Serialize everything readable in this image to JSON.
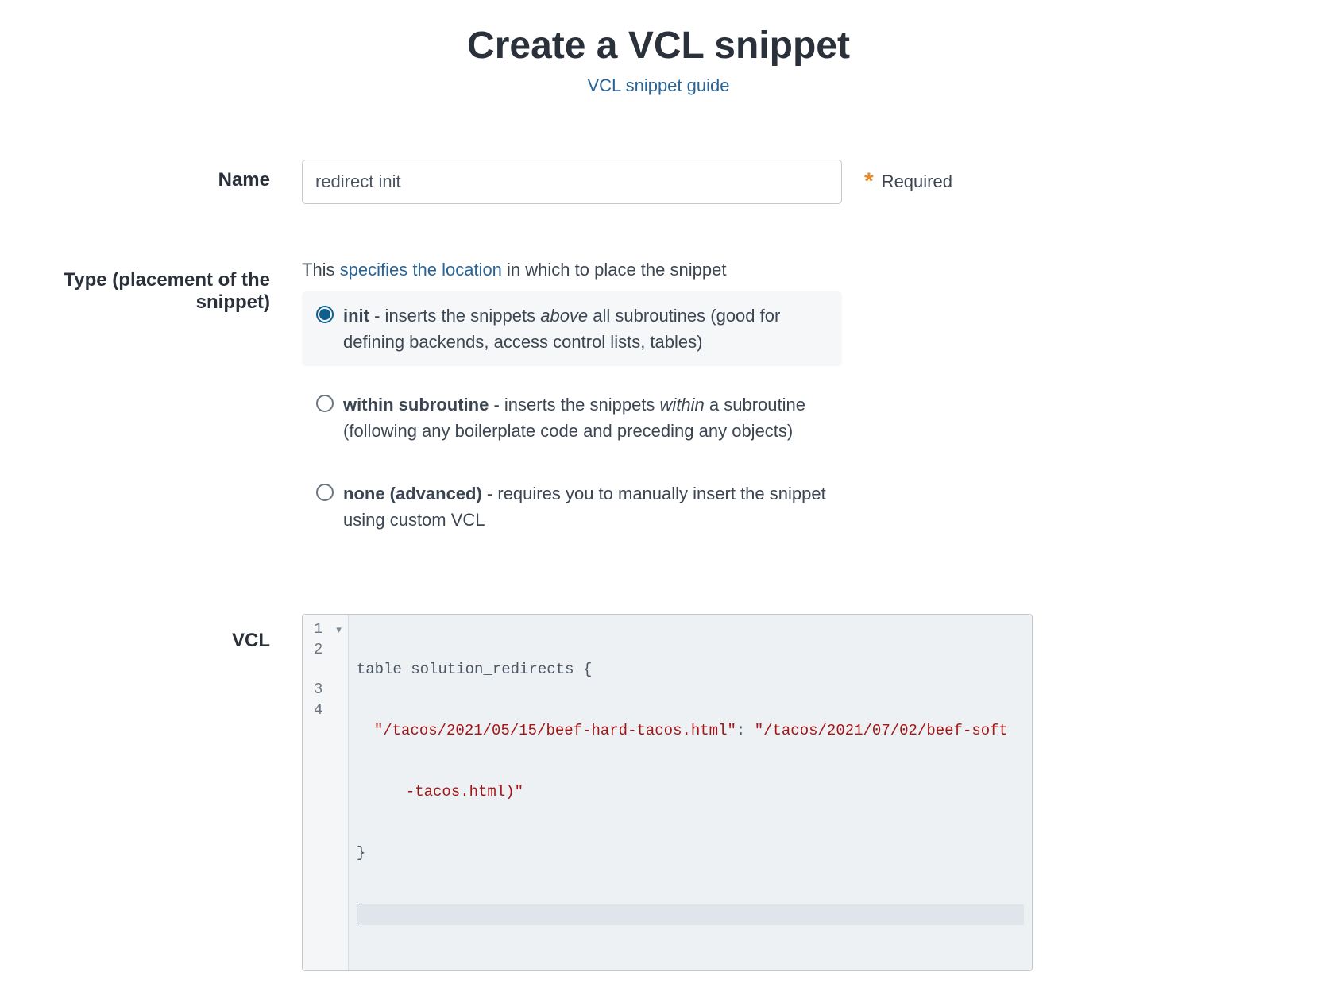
{
  "header": {
    "title": "Create a VCL snippet",
    "guide_link": "VCL snippet guide"
  },
  "name": {
    "label": "Name",
    "value": "redirect init",
    "required_marker": "*",
    "required_text": "Required"
  },
  "type": {
    "label": "Type (placement of the snippet)",
    "intro_prefix": "This ",
    "intro_link": "specifies the location",
    "intro_suffix": " in which to place the snippet",
    "options": [
      {
        "name": "init",
        "desc_before": " - inserts the snippets ",
        "desc_em": "above",
        "desc_after": " all subroutines (good for defining backends, access control lists, tables)",
        "selected": true
      },
      {
        "name": "within subroutine",
        "desc_before": " - inserts the snippets ",
        "desc_em": "within",
        "desc_after": " a subroutine (following any boilerplate code and preceding any objects)",
        "selected": false
      },
      {
        "name": "none (advanced)",
        "desc_before": " - requires you to manually insert the snippet using custom VCL",
        "desc_em": "",
        "desc_after": "",
        "selected": false
      }
    ]
  },
  "vcl": {
    "label": "VCL",
    "gutter": [
      "1",
      "2",
      "3",
      "4"
    ],
    "code": {
      "line1_kw": "table",
      "line1_id": "solution_redirects",
      "line1_brace": "{",
      "line2_key": "\"/tacos/2021/05/15/beef-hard-tacos.html\"",
      "line2_colon": ": ",
      "line2_val_a": "\"/tacos/2021/07/02/beef-soft",
      "line2_val_b": "-tacos.html)\"",
      "line3_brace": "}"
    }
  }
}
